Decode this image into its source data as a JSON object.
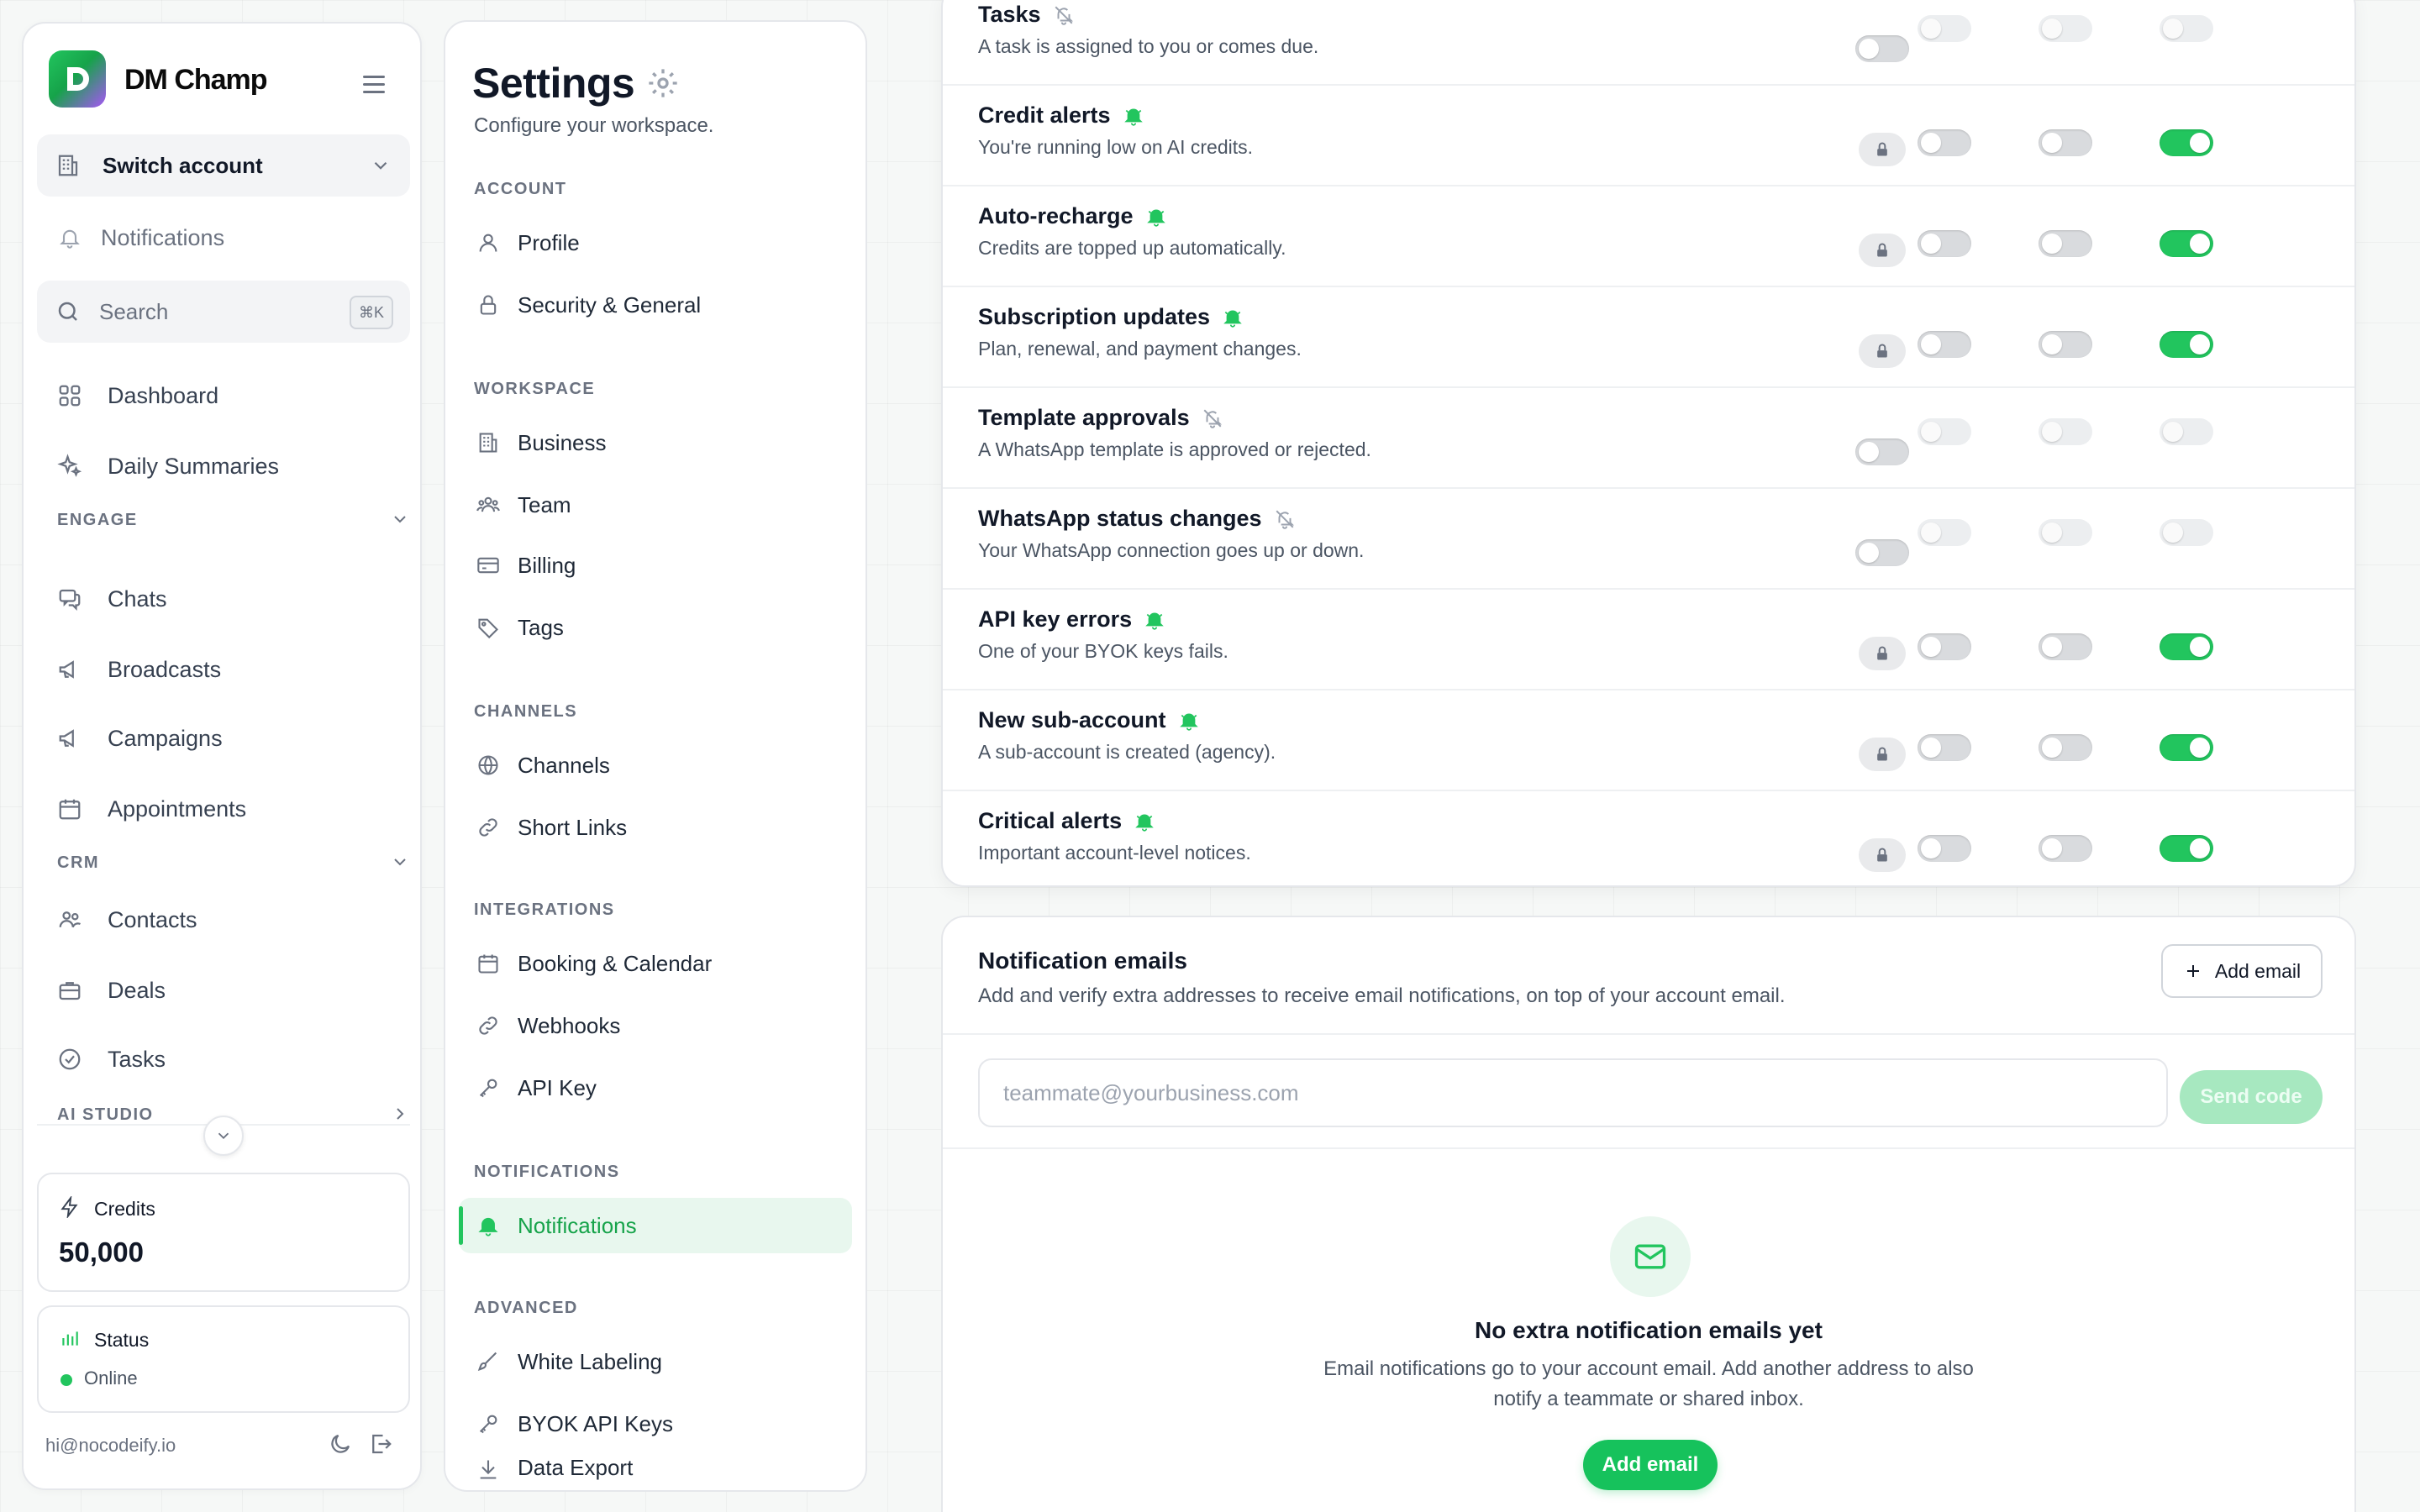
{
  "brand": {
    "name": "DM Champ",
    "logo_letter": "D"
  },
  "sidebar": {
    "switch_account": "Switch account",
    "notifications": "Notifications",
    "search_placeholder": "Search",
    "search_shortcut": "⌘K",
    "dashboard": "Dashboard",
    "daily_summaries": "Daily Summaries",
    "engage_label": "ENGAGE",
    "engage_items": [
      "Chats",
      "Broadcasts",
      "Campaigns",
      "Appointments"
    ],
    "crm_label": "CRM",
    "crm_items": [
      "Contacts",
      "Deals",
      "Tasks"
    ],
    "ai_studio_label": "AI STUDIO",
    "credits_label": "Credits",
    "credits_value": "50,000",
    "status_label": "Status",
    "status_value": "Online",
    "email": "hi@nocodeify.io"
  },
  "settings": {
    "title": "Settings",
    "subtitle": "Configure your workspace.",
    "sections": [
      {
        "label": "ACCOUNT",
        "items": [
          "Profile",
          "Security & General"
        ]
      },
      {
        "label": "WORKSPACE",
        "items": [
          "Business",
          "Team",
          "Billing",
          "Tags"
        ]
      },
      {
        "label": "CHANNELS",
        "items": [
          "Channels",
          "Short Links"
        ]
      },
      {
        "label": "INTEGRATIONS",
        "items": [
          "Booking & Calendar",
          "Webhooks",
          "API Key"
        ]
      },
      {
        "label": "NOTIFICATIONS",
        "items": [
          "Notifications"
        ]
      },
      {
        "label": "ADVANCED",
        "items": [
          "White Labeling",
          "BYOK API Keys",
          "Data Export"
        ]
      }
    ],
    "active_item": "Notifications"
  },
  "notifications": {
    "rows": [
      {
        "title": "Tasks",
        "desc": "A task is assigned to you or comes due.",
        "bell": "muted",
        "locked": false,
        "enabled": false
      },
      {
        "title": "Credit alerts",
        "desc": "You're running low on AI credits.",
        "bell": "active",
        "locked": true,
        "enabled": true
      },
      {
        "title": "Auto-recharge",
        "desc": "Credits are topped up automatically.",
        "bell": "active",
        "locked": true,
        "enabled": true
      },
      {
        "title": "Subscription updates",
        "desc": "Plan, renewal, and payment changes.",
        "bell": "active",
        "locked": true,
        "enabled": true
      },
      {
        "title": "Template approvals",
        "desc": "A WhatsApp template is approved or rejected.",
        "bell": "muted",
        "locked": false,
        "enabled": false
      },
      {
        "title": "WhatsApp status changes",
        "desc": "Your WhatsApp connection goes up or down.",
        "bell": "muted",
        "locked": false,
        "enabled": false
      },
      {
        "title": "API key errors",
        "desc": "One of your BYOK keys fails.",
        "bell": "active",
        "locked": true,
        "enabled": true
      },
      {
        "title": "New sub-account",
        "desc": "A sub-account is created (agency).",
        "bell": "active",
        "locked": true,
        "enabled": true
      },
      {
        "title": "Critical alerts",
        "desc": "Important account-level notices.",
        "bell": "active",
        "locked": true,
        "enabled": true
      }
    ]
  },
  "emails": {
    "title": "Notification emails",
    "desc": "Add and verify extra addresses to receive email notifications, on top of your account email.",
    "add_button": "Add email",
    "input_placeholder": "teammate@yourbusiness.com",
    "send_code": "Send code",
    "empty_title": "No extra notification emails yet",
    "empty_desc_line1": "Email notifications go to your account email. Add another address to also",
    "empty_desc_line2": "notify a teammate or shared inbox.",
    "empty_button": "Add email"
  },
  "colors": {
    "accent": "#22c55e",
    "accent_bg": "#e8f7ee",
    "muted": "#9ca3af"
  }
}
